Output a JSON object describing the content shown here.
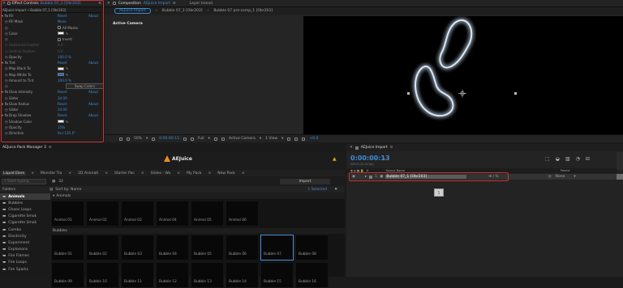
{
  "effects_panel": {
    "tab_prefix": "Effect Controls",
    "tab_layer": "Bubble 07_1 [Obr203]",
    "breadcrumb": "AEJuice Import • Bubble 07_1 [Obr203]",
    "rows": [
      {
        "name": "Fill",
        "tw": "fx",
        "value": "Reset",
        "extra": "About"
      },
      {
        "name": "Fill Mask",
        "value": "None"
      },
      {
        "name": "",
        "check": "All Masks"
      },
      {
        "name": "Color",
        "swatch": "#ffffff"
      },
      {
        "name": "",
        "check": "Invert"
      },
      {
        "name": "Horizontal Feather",
        "value": "0.0",
        "dim": true
      },
      {
        "name": "Vertical Feather",
        "value": "0.0",
        "dim": true
      },
      {
        "name": "Opacity",
        "value": "100.0 %"
      },
      {
        "name": "Tint",
        "tw": "fx",
        "value": "Reset",
        "extra": "About"
      },
      {
        "name": "Map Black To",
        "swatch": "#ffffff"
      },
      {
        "name": "Map White To",
        "swatch": "#1d66d8"
      },
      {
        "name": "Amount to Tint",
        "value": "100.0 %"
      },
      {
        "name": "",
        "button": "Swap Colors"
      },
      {
        "name": "Glow Intensity",
        "tw": "fx",
        "value": "Reset",
        "extra": "About"
      },
      {
        "name": "Slider",
        "value": "34.00"
      },
      {
        "name": "Glow Radius",
        "tw": "fx",
        "value": "Reset",
        "extra": "About"
      },
      {
        "name": "Slider",
        "value": "24.00"
      },
      {
        "name": "Drop Shadow",
        "tw": "fx",
        "value": "Reset",
        "extra": "About"
      },
      {
        "name": "Shadow Color",
        "swatch": "#ffffff"
      },
      {
        "name": "Opacity",
        "value": "15%"
      },
      {
        "name": "Direction",
        "value": "0x+135.0°"
      }
    ],
    "badge": "2"
  },
  "comp_panel": {
    "tab_prefix": "Composition",
    "tab_name": "AEJuice Import",
    "layer_tab": "Layer (none)",
    "breadcrumbs": [
      "AEJuice Import",
      "Bubble 07_1 [Obr203]",
      "Bubble 07 pre-comp_1 [Obr203]"
    ],
    "camera_label": "Active Camera",
    "bottom_bar": {
      "zoom": "50%",
      "time": "0:00:00:13",
      "resolution": "Full",
      "camera": "Active Camera",
      "view": "1 View",
      "exposure": "+0.0"
    }
  },
  "pack_manager": {
    "title": "AEJuice Pack Manager 3",
    "logo": "AEJuice",
    "tabs": [
      "Liquid Elem",
      "Monster Tra",
      "2D Animati",
      "Starter Pac",
      "Slides - Wo",
      "My Pack",
      "New Pack"
    ],
    "search_placeholder": "Start typing",
    "thumb_size": "32",
    "import_label": "Import",
    "folders_label": "Folders",
    "sort_label": "Sort by: Name",
    "selected_label": "1 Selected",
    "folders": [
      "Animals",
      "Bubbles",
      "Chaos Loops",
      "Cigarette Smok",
      "Cigarette Smok",
      "Combo",
      "Electricity",
      "Experiment",
      "Explosions",
      "Fire Flames",
      "Fire Loops",
      "Fire Sparks"
    ],
    "sections": [
      "Animals",
      "Bubbles"
    ],
    "animals": [
      "Animal 01",
      "Animal 02",
      "Animal 03",
      "Animal 04",
      "Animal 05",
      "Animal 06"
    ],
    "bubbles_row1": [
      "Bubble 01",
      "Bubble 02",
      "Bubble 03",
      "Bubble 04",
      "Bubble 05",
      "Bubble 06",
      "Bubble 07",
      "Bubble 08"
    ],
    "bubbles_row2": [
      "Bubble 09",
      "Bubble 10",
      "Bubble 11",
      "Bubble 12",
      "Bubble 13",
      "Bubble 14",
      "Bubble 15",
      "Bubble 16"
    ]
  },
  "timeline": {
    "tab_name": "AEJuice Import",
    "timecode": "0:00:00:13",
    "frames": "00013 (25.00 fps)",
    "source_header": "Source Name",
    "parent_header": "Parent",
    "layer_number": "1",
    "layer_name": "Bubble 07_1 [Obr203]",
    "parent_value": "None",
    "badge": "1",
    "accent": "#3c8fd6"
  }
}
